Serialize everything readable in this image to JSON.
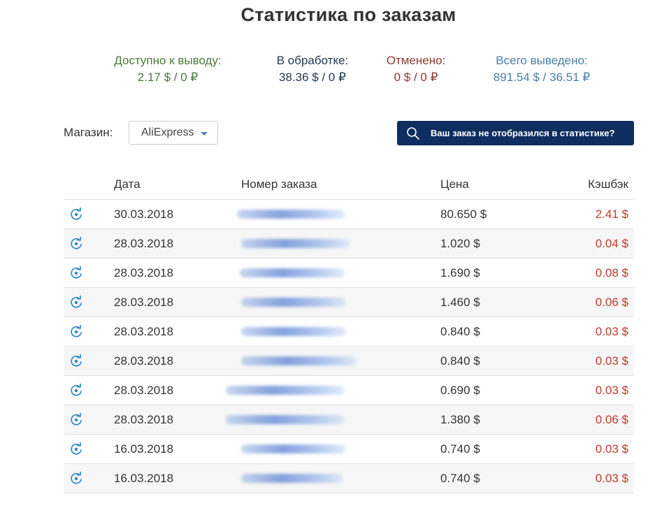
{
  "page": {
    "title": "Статистика по заказам"
  },
  "stats": {
    "available": {
      "label": "Доступно к выводу:",
      "value": "2.17 $ / 0 ₽"
    },
    "processing": {
      "label": "В обработке:",
      "value": "38.36 $ / 0 ₽"
    },
    "cancelled": {
      "label": "Отменено:",
      "value": "0 $ / 0 ₽"
    },
    "withdrawn": {
      "label": "Всего выведено:",
      "value": "891.54 $ / 36.51 ₽"
    }
  },
  "filter": {
    "shop_label": "Магазин:",
    "shop_selected": "AliExpress",
    "caret_icon": "chevron-down-icon"
  },
  "missing_order_button": {
    "label": "Ваш заказ не отобразился в статистике?",
    "icon": "search-icon",
    "background": "#0d2e5f"
  },
  "table": {
    "headers": {
      "date": "Дата",
      "order": "Номер заказа",
      "price": "Цена",
      "cashback": "Кэшбэк"
    },
    "status_icon": "sync-icon",
    "accent_color": "#c0392b",
    "rows": [
      {
        "date": "30.03.2018",
        "order_number_blurred": true,
        "price": "80.650 $",
        "cashback": "2.41 $"
      },
      {
        "date": "28.03.2018",
        "order_number_blurred": true,
        "price": "1.020 $",
        "cashback": "0.04 $"
      },
      {
        "date": "28.03.2018",
        "order_number_blurred": true,
        "price": "1.690 $",
        "cashback": "0.08 $"
      },
      {
        "date": "28.03.2018",
        "order_number_blurred": true,
        "price": "1.460 $",
        "cashback": "0.06 $"
      },
      {
        "date": "28.03.2018",
        "order_number_blurred": true,
        "price": "0.840 $",
        "cashback": "0.03 $"
      },
      {
        "date": "28.03.2018",
        "order_number_blurred": true,
        "price": "0.840 $",
        "cashback": "0.03 $"
      },
      {
        "date": "28.03.2018",
        "order_number_blurred": true,
        "price": "0.690 $",
        "cashback": "0.03 $"
      },
      {
        "date": "28.03.2018",
        "order_number_blurred": true,
        "price": "1.380 $",
        "cashback": "0.06 $"
      },
      {
        "date": "16.03.2018",
        "order_number_blurred": true,
        "price": "0.740 $",
        "cashback": "0.03 $"
      },
      {
        "date": "16.03.2018",
        "order_number_blurred": true,
        "price": "0.740 $",
        "cashback": "0.03 $"
      }
    ]
  }
}
